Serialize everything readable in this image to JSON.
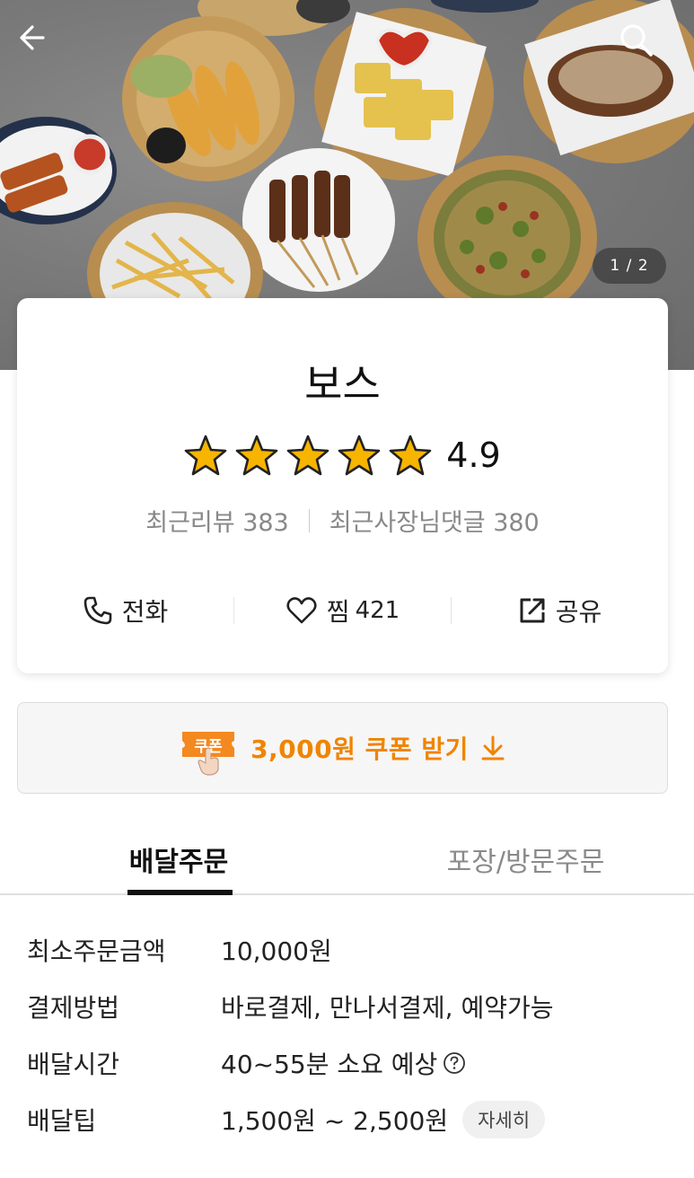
{
  "hero": {
    "page_indicator": "1 / 2",
    "back_icon": "arrow-left-icon",
    "search_icon": "search-icon"
  },
  "store": {
    "name": "보스",
    "rating": "4.9",
    "star_count": 5,
    "star_color": "#f7b500",
    "recent_reviews": "최근리뷰 383",
    "owner_replies": "최근사장님댓글 380",
    "actions": {
      "call": "전화",
      "favorite": "찜",
      "favorite_count": "421",
      "share": "공유"
    }
  },
  "coupon": {
    "badge": "쿠폰",
    "label": "3,000원 쿠폰 받기",
    "accent_color": "#f08400"
  },
  "tabs": [
    {
      "label": "배달주문",
      "active": true
    },
    {
      "label": "포장/방문주문",
      "active": false
    }
  ],
  "delivery_info": {
    "min_order": {
      "label": "최소주문금액",
      "value": "10,000원"
    },
    "payment": {
      "label": "결제방법",
      "value": "바로결제, 만나서결제, 예약가능"
    },
    "delivery_time": {
      "label": "배달시간",
      "value": "40~55분 소요 예상"
    },
    "delivery_tip": {
      "label": "배달팁",
      "value": "1,500원 ~ 2,500원",
      "detail_button": "자세히"
    }
  }
}
